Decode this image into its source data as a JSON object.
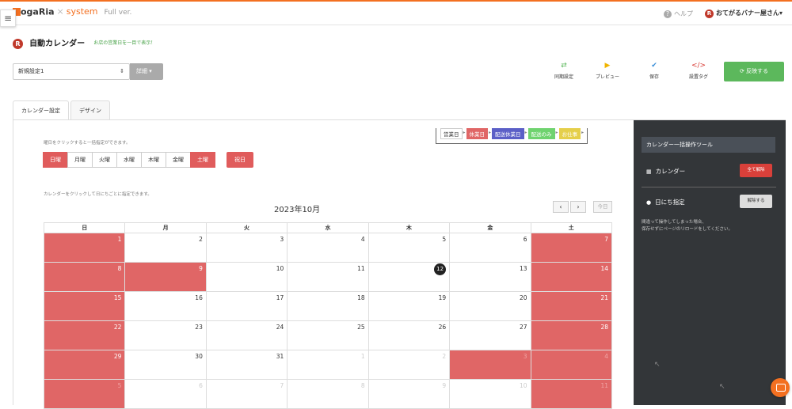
{
  "header": {
    "logo_main": "ogaRia",
    "logo_x": "×",
    "logo_system": "system",
    "logo_ver": "Full ver.",
    "help": "ヘルプ",
    "user_badge": "R",
    "user_name": "おてがるバナー屋さん▾"
  },
  "page": {
    "badge": "R",
    "title": "自動カレンダー",
    "subtitle": "お店の営業日を一目で表示！"
  },
  "toolbar": {
    "preset_value": "新規設定1",
    "detail_label": "詳細 ▾",
    "tools": [
      {
        "icon": "⇄",
        "label": "同期設定",
        "color": "#5cb85c"
      },
      {
        "icon": "▶",
        "label": "プレビュー",
        "color": "#f0b400"
      },
      {
        "icon": "✔",
        "label": "保存",
        "color": "#3a8fd8"
      },
      {
        "icon": "</>",
        "label": "設置タグ",
        "color": "#d9403a"
      }
    ],
    "publish_label": "⟳   反映する"
  },
  "tabs": [
    "カレンダー設定",
    "デザイン"
  ],
  "weekday_section": {
    "hint": "曜日をクリックすると一括指定ができます。",
    "days": [
      {
        "label": "日曜",
        "on": true
      },
      {
        "label": "月曜",
        "on": false
      },
      {
        "label": "火曜",
        "on": false
      },
      {
        "label": "水曜",
        "on": false
      },
      {
        "label": "木曜",
        "on": false
      },
      {
        "label": "金曜",
        "on": false
      },
      {
        "label": "土曜",
        "on": true
      }
    ],
    "holiday_label": "祝日"
  },
  "legend": [
    {
      "label": "営業日",
      "bg": "#ffffff",
      "fg": "#333333",
      "border": "#cccccc"
    },
    {
      "label": "休業日",
      "bg": "#e06666",
      "fg": "#ffffff",
      "border": "#e06666"
    },
    {
      "label": "配送休業日",
      "bg": "#5b5fc7",
      "fg": "#ffffff",
      "border": "#5b5fc7"
    },
    {
      "label": "配送のみ",
      "bg": "#6fd36f",
      "fg": "#ffffff",
      "border": "#6fd36f"
    },
    {
      "label": "お仕事",
      "bg": "#e5cf4a",
      "fg": "#ffffff",
      "border": "#e5cf4a"
    }
  ],
  "calendar": {
    "hint": "カレンダーをクリックして日にちごとに指定できます。",
    "month_title": "2023年10月",
    "prev": "‹",
    "next": "›",
    "today_label": "今日",
    "weekday_headers": [
      "日",
      "月",
      "火",
      "水",
      "木",
      "金",
      "土"
    ],
    "weeks": [
      [
        {
          "d": "1",
          "h": true
        },
        {
          "d": "2"
        },
        {
          "d": "3"
        },
        {
          "d": "4"
        },
        {
          "d": "5"
        },
        {
          "d": "6"
        },
        {
          "d": "7",
          "h": true
        }
      ],
      [
        {
          "d": "8",
          "h": true
        },
        {
          "d": "9",
          "h": true
        },
        {
          "d": "10"
        },
        {
          "d": "11"
        },
        {
          "d": "12",
          "today": true
        },
        {
          "d": "13"
        },
        {
          "d": "14",
          "h": true
        }
      ],
      [
        {
          "d": "15",
          "h": true
        },
        {
          "d": "16"
        },
        {
          "d": "17"
        },
        {
          "d": "18"
        },
        {
          "d": "19"
        },
        {
          "d": "20"
        },
        {
          "d": "21",
          "h": true
        }
      ],
      [
        {
          "d": "22",
          "h": true
        },
        {
          "d": "23"
        },
        {
          "d": "24"
        },
        {
          "d": "25"
        },
        {
          "d": "26"
        },
        {
          "d": "27"
        },
        {
          "d": "28",
          "h": true
        }
      ],
      [
        {
          "d": "29",
          "h": true
        },
        {
          "d": "30"
        },
        {
          "d": "31"
        },
        {
          "d": "1",
          "o": true
        },
        {
          "d": "2",
          "o": true
        },
        {
          "d": "3",
          "o": true,
          "h": true
        },
        {
          "d": "4",
          "o": true,
          "h": true
        }
      ],
      [
        {
          "d": "5",
          "o": true,
          "h": true
        },
        {
          "d": "6",
          "o": true
        },
        {
          "d": "7",
          "o": true
        },
        {
          "d": "8",
          "o": true
        },
        {
          "d": "9",
          "o": true
        },
        {
          "d": "10",
          "o": true
        },
        {
          "d": "11",
          "o": true,
          "h": true
        }
      ]
    ]
  },
  "sidebar": {
    "title": "カレンダー一括操作ツール",
    "calendar_label": "カレンダー",
    "clear_all": "全て解除",
    "day_label": "日にち指定",
    "release": "解除する",
    "note_line1": "間違って操作してしまった場合、",
    "note_line2": "保存せずにページのリロードをしてください。"
  }
}
